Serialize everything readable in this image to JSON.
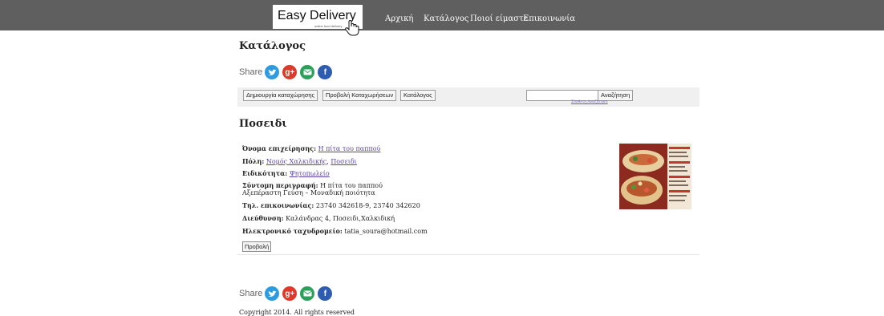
{
  "header": {
    "logo": "Easy Delivery",
    "logo_sub": "online food delivery",
    "nav": [
      "Αρχική",
      "Κατάλογος",
      "Ποιοί είμαστε",
      "Επικοινωνία"
    ]
  },
  "page_title": "Κατάλογος",
  "share_label": "Share",
  "toolbar": {
    "buttons": [
      "Δημιουργία καταχώρησης",
      "Προβολή Καταχωρήσεων",
      "Κατάλογος"
    ],
    "search_value": "",
    "search_button": "Αναζήτηση",
    "advanced_link": "Σύνθετη Αναζήτηση"
  },
  "section_title": "Ποσειδι",
  "entry": {
    "name_label": "Όνομα επιχείρησης:",
    "name_value": "Η πίτα του παππού",
    "city_label": "Πόλη:",
    "city_value_1": "Νομός Χαλκιδικής",
    "city_value_2": "Ποσειδι",
    "specialty_label": "Ειδικότητα:",
    "specialty_value": "Ψητοπωλείο",
    "desc_label": "Σύντομη περιγραφή:",
    "desc_line1": "Η πίτα του παππού",
    "desc_line2": "Αξεπέραστη Γεύση – Μοναδική ποιότητα",
    "phone_label": "Τηλ. επικοινωνίας:",
    "phone_value": "23740 342618-9, 23740 342620",
    "address_label": "Διεύθυνση:",
    "address_value": "Καλάνδρας 4, Ποσειδι,Χαλκιδική",
    "email_label": "Ηλεκτρονικό ταχυδρομείο:",
    "email_value": "tatia_soura@hotmail.com",
    "view_button": "Προβολή"
  },
  "footer": {
    "copyright": "Copyright 2014. All rights reserved"
  },
  "colors": {
    "topbar": "#5f5f5f",
    "twitter": "#2d9be0",
    "googleplus": "#dd3b2a",
    "email": "#2ba05b",
    "facebook": "#2e5cb0"
  },
  "icons": [
    "twitter-icon",
    "googleplus-icon",
    "email-icon",
    "facebook-icon",
    "hand-cursor-icon"
  ]
}
